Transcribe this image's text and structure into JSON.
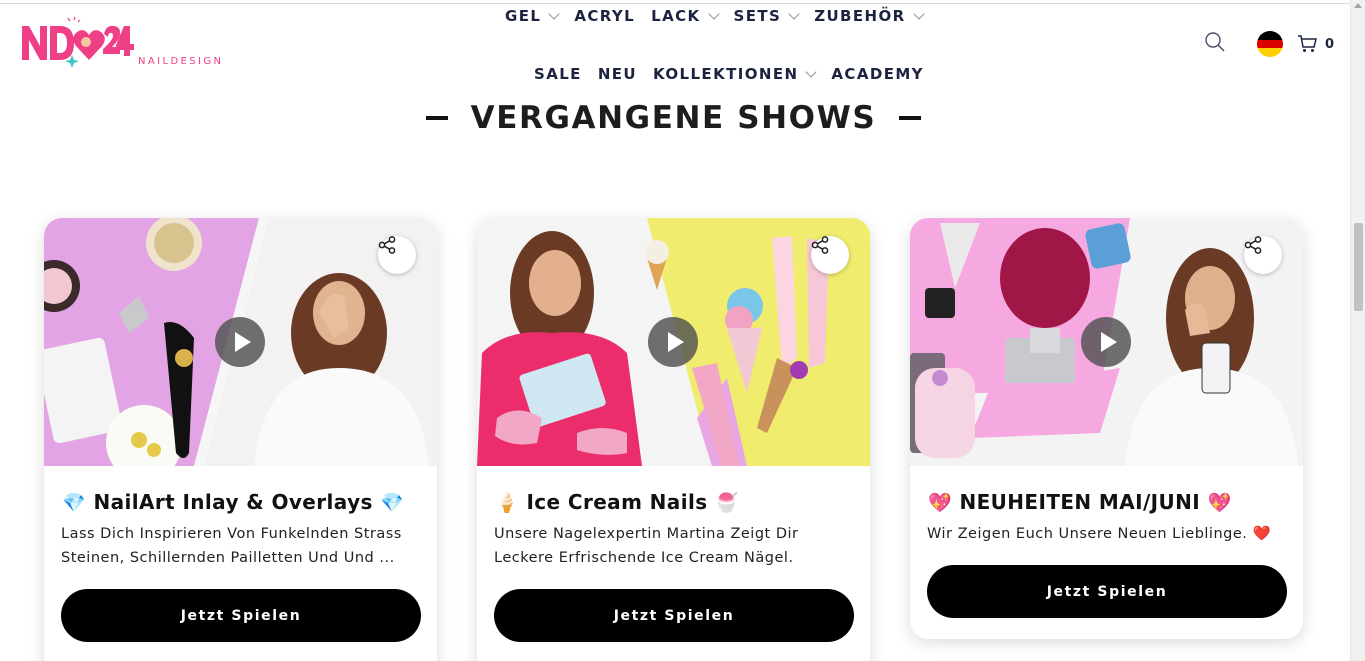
{
  "brand": {
    "logo_text": "ND24",
    "logo_subtitle": "NAILDESIGN"
  },
  "nav": {
    "row1": [
      {
        "label": "GEL",
        "has_dropdown": true
      },
      {
        "label": "ACRYL",
        "has_dropdown": false
      },
      {
        "label": "LACK",
        "has_dropdown": true
      },
      {
        "label": "SETS",
        "has_dropdown": true
      },
      {
        "label": "ZUBEHÖR",
        "has_dropdown": true
      }
    ],
    "row2": [
      {
        "label": "SALE",
        "has_dropdown": false
      },
      {
        "label": "NEU",
        "has_dropdown": false
      },
      {
        "label": "KOLLEKTIONEN",
        "has_dropdown": true
      },
      {
        "label": "ACADEMY",
        "has_dropdown": false
      }
    ]
  },
  "header": {
    "search_icon": "search-icon",
    "language_flag": "germany-flag-icon",
    "cart_icon": "cart-icon",
    "cart_count": "0"
  },
  "section": {
    "title": "VERGANGENE SHOWS"
  },
  "shows": [
    {
      "title": "NailArt Inlay & Overlays",
      "emoji_left": "💎",
      "emoji_right": "💎",
      "description": "Lass Dich Inspirieren Von Funkelnden Strass Steinen, Schillernden Pailletten Und Und ...",
      "cta": "Jetzt Spielen"
    },
    {
      "title": "Ice Cream Nails",
      "emoji_left": "🍦",
      "emoji_right": "🍧",
      "description": "Unsere Nagelexpertin Martina Zeigt Dir Leckere Erfrischende Ice Cream Nägel.",
      "cta": "Jetzt Spielen"
    },
    {
      "title": "NEUHEITEN MAI/JUNI",
      "emoji_left": "💖",
      "emoji_right": "💖",
      "description": "Wir Zeigen Euch Unsere Neuen Lieblinge. ❤️",
      "cta": "Jetzt Spielen"
    }
  ],
  "colors": {
    "brand_pink": "#ef3f86",
    "nav_text": "#1c2340",
    "button_bg": "#000000"
  }
}
